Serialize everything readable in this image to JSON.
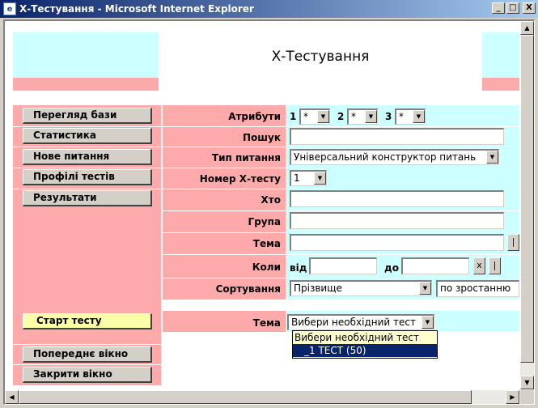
{
  "window": {
    "title": "Х-Тестування - Microsoft Internet Explorer",
    "app_icon": "ie-icon",
    "minimize": "_",
    "maximize": "□",
    "close": "X"
  },
  "page": {
    "title": "Х-Тестування"
  },
  "nav_buttons": [
    {
      "label": "Перегляд бази"
    },
    {
      "label": "Статистика"
    },
    {
      "label": "Нове питання"
    },
    {
      "label": "Профілі тестів"
    },
    {
      "label": "Результати"
    }
  ],
  "form": {
    "attributes": {
      "label": "Атрибути",
      "items": [
        {
          "index": "1",
          "value": "*"
        },
        {
          "index": "2",
          "value": "*"
        },
        {
          "index": "3",
          "value": "*"
        }
      ]
    },
    "search": {
      "label": "Пошук",
      "value": ""
    },
    "question_type": {
      "label": "Тип питання",
      "value": "Універсальний конструктор питань"
    },
    "x_test_number": {
      "label": "Номер Х-тесту",
      "value": "1"
    },
    "who": {
      "label": "Хто",
      "value": ""
    },
    "group": {
      "label": "Група",
      "value": ""
    },
    "topic": {
      "label": "Тема",
      "value": "",
      "side_button": "|"
    },
    "when": {
      "label": "Коли",
      "from_label": "від",
      "to_label": "до",
      "from": "",
      "to": "",
      "clear_button": "x",
      "side_button": "|"
    },
    "sort": {
      "label": "Сортування",
      "field": "Прізвище",
      "order": "по зростанню"
    }
  },
  "start": {
    "button": "Старт тесту",
    "topic_label": "Тема",
    "selected": "Вибери необхідний тест",
    "options": [
      "Вибери необхідний тест",
      "_1 ТЕСТ (50)"
    ]
  },
  "bottom_buttons": [
    {
      "label": "Попереднє вікно"
    },
    {
      "label": "Закрити вікно"
    }
  ],
  "colors": {
    "pink": "#ffaaaa",
    "cyan": "#ccffff",
    "title_bar": "#0a246a",
    "start_button": "#ffffaa"
  }
}
